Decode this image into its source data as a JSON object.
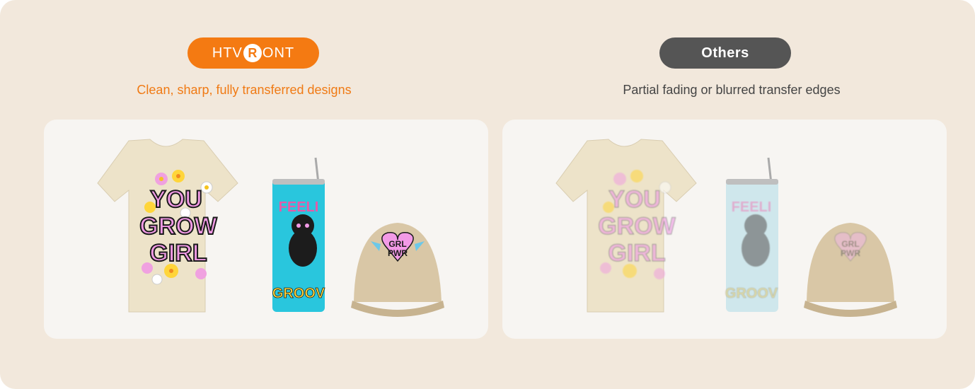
{
  "comparison": {
    "left": {
      "brand_text_before": "HTV",
      "brand_glyph": "R",
      "brand_text_after": "ONT",
      "tagline": "Clean, sharp, fully transferred designs",
      "accent": "#f47a12"
    },
    "right": {
      "badge_label": "Others",
      "tagline": "Partial fading or blurred transfer edges",
      "badge_color": "#555555"
    }
  },
  "products": {
    "shirt_text": [
      "YOU",
      "GROW",
      "GIRL"
    ],
    "tumbler_top": "FEELI",
    "tumbler_bottom": "GROOV",
    "cap_text": [
      "GRL",
      "PWR"
    ]
  }
}
